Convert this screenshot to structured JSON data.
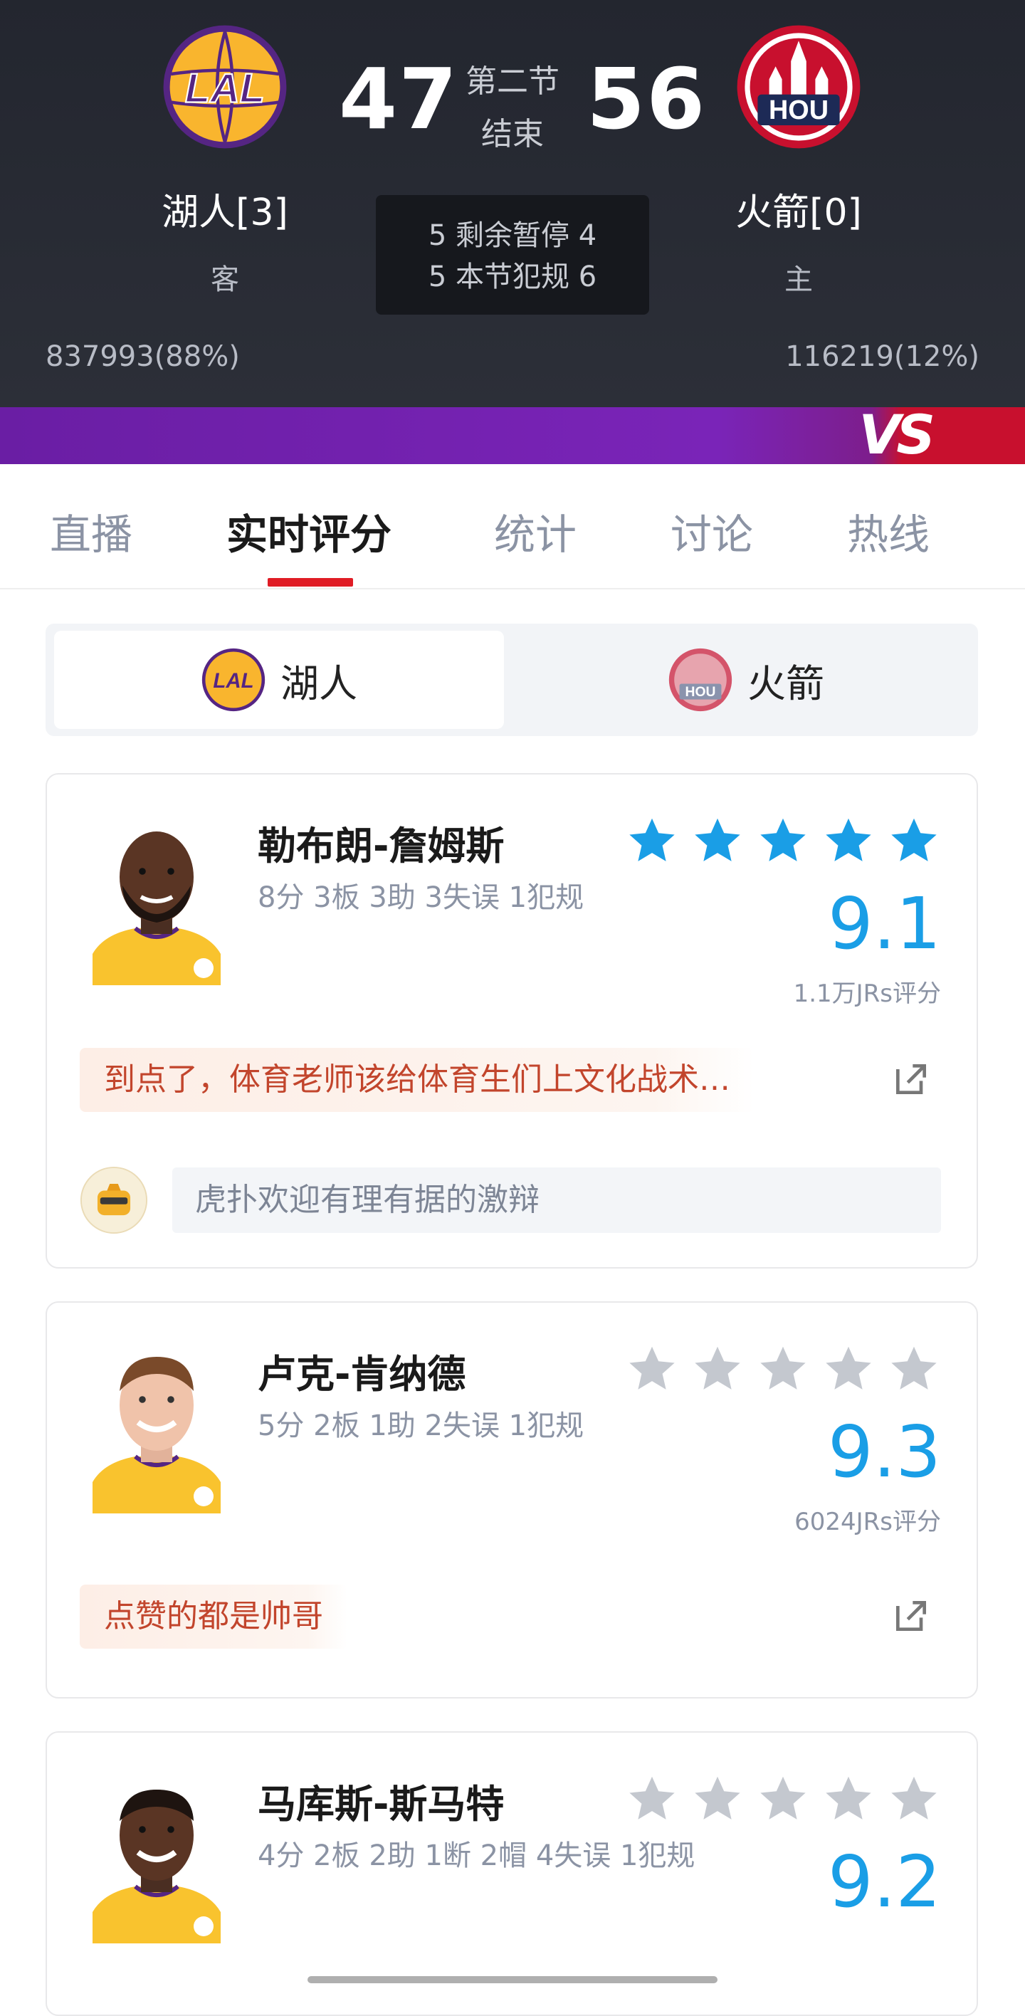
{
  "header": {
    "away_team": {
      "name": "湖人[3]",
      "side": "客",
      "score": "47",
      "support": "837993(88%)",
      "logo_text": "LAL",
      "color": "#552583",
      "accent": "#f9b52e"
    },
    "home_team": {
      "name": "火箭[0]",
      "side": "主",
      "score": "56",
      "support": "116219(12%)",
      "logo_text": "HOU",
      "color": "#c8102e"
    },
    "period_label": "第二节",
    "period_status": "结束",
    "timeouts_line": "5 剩余暂停 4",
    "fouls_line": "5 本节犯规 6",
    "vs_text": "VS"
  },
  "tabs": [
    {
      "label": "直播",
      "active": false
    },
    {
      "label": "实时评分",
      "active": true
    },
    {
      "label": "统计",
      "active": false
    },
    {
      "label": "讨论",
      "active": false
    },
    {
      "label": "热线",
      "active": false
    }
  ],
  "team_toggle": {
    "active": {
      "label": "湖人",
      "logo_text": "LAL"
    },
    "inactive": {
      "label": "火箭",
      "logo_text": "HOU"
    }
  },
  "players": [
    {
      "name": "勒布朗-詹姆斯",
      "stats": "8分 3板 3助 3失误 1犯规",
      "stars_filled": 5,
      "star_color": "#1a9ee6",
      "score": "9.1",
      "ratings_count": "1.1万JRs评分",
      "top_comment": "到点了，体育老师该给体育生们上文化战术…",
      "comment_placeholder": "虎扑欢迎有理有据的激辩"
    },
    {
      "name": "卢克-肯纳德",
      "stats": "5分 2板 1助 2失误 1犯规",
      "stars_filled": 0,
      "star_color": "#c4c8cf",
      "score": "9.3",
      "ratings_count": "6024JRs评分",
      "top_comment": "点赞的都是帅哥"
    },
    {
      "name": "马库斯-斯马特",
      "stats": "4分 2板 2助 1断 2帽 4失误 1犯规",
      "stars_filled": 0,
      "star_color": "#c4c8cf",
      "score": "9.2"
    }
  ]
}
